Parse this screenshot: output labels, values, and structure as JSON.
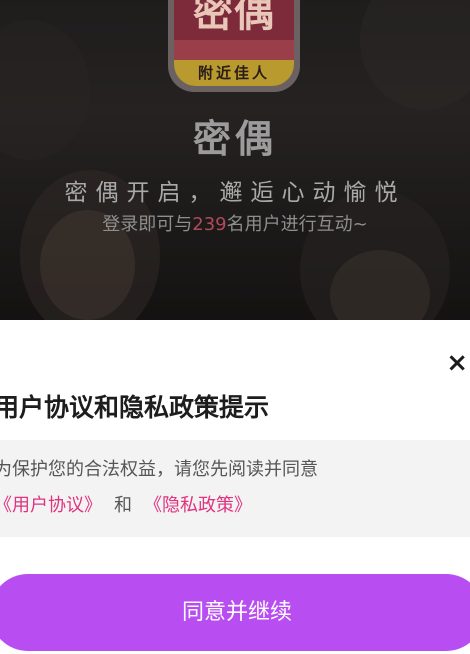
{
  "background": {
    "logo_glyph": "密偶",
    "logo_tag": "附近佳人",
    "app_name": "密偶",
    "slogan": "密偶开启，邂逅心动愉悦",
    "subline_prefix": "登录即可与",
    "user_count": "239",
    "subline_suffix": "名用户进行互动~"
  },
  "sheet": {
    "close_icon": "close-icon",
    "close_glyph": "×",
    "title": "用户协议和隐私政策提示",
    "notice": "为保护您的合法权益，请您先阅读并同意",
    "user_agreement_link": "《用户协议》",
    "conjunction": "和",
    "privacy_policy_link": "《隐私政策》",
    "agree_button": "同意并继续"
  },
  "colors": {
    "accent_button": "#b84ef2",
    "link": "#e0327f",
    "highlight_count": "#b24a5a"
  }
}
